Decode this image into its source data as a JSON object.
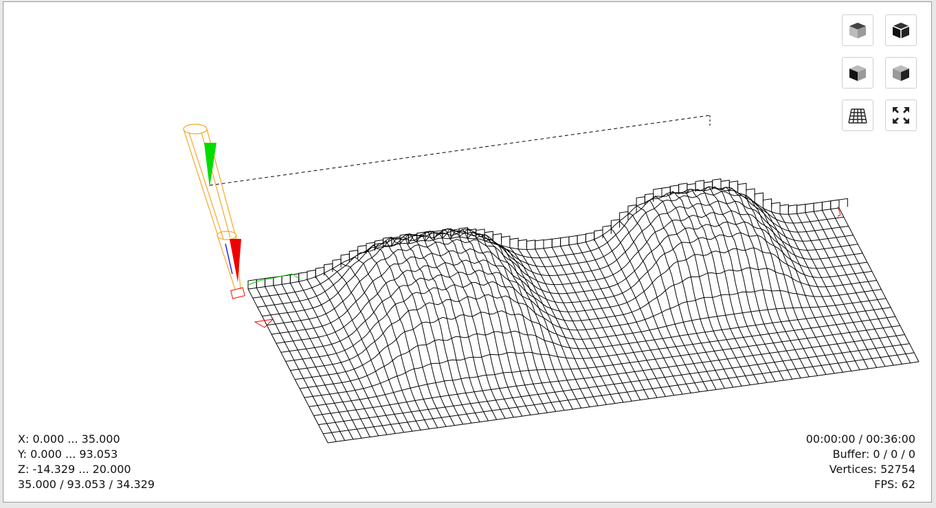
{
  "bounds": {
    "x": "X: 0.000 ... 35.000",
    "y": "Y: 0.000 ... 93.053",
    "z": "Z: -14.329 ... 20.000",
    "size": "35.000 / 93.053 / 34.329"
  },
  "status": {
    "time": "00:00:00 / 00:36:00",
    "buffer": "Buffer: 0 / 0 / 0",
    "vertices": "Vertices: 52754",
    "fps": "FPS: 62"
  },
  "view_buttons": [
    {
      "name": "view-top-button",
      "icon": "cube-top-icon"
    },
    {
      "name": "view-3d-button",
      "icon": "cube-iso-icon"
    },
    {
      "name": "view-front-button",
      "icon": "cube-front-icon"
    },
    {
      "name": "view-side-button",
      "icon": "cube-side-icon"
    },
    {
      "name": "grid-toggle-button",
      "icon": "grid-icon"
    },
    {
      "name": "fit-view-button",
      "icon": "expand-icon"
    }
  ],
  "colors": {
    "mesh": "#000000",
    "tool": "#f5a623",
    "axis_x": "#ff0000",
    "axis_y": "#00cc00",
    "axis_z": "#0000ff"
  }
}
